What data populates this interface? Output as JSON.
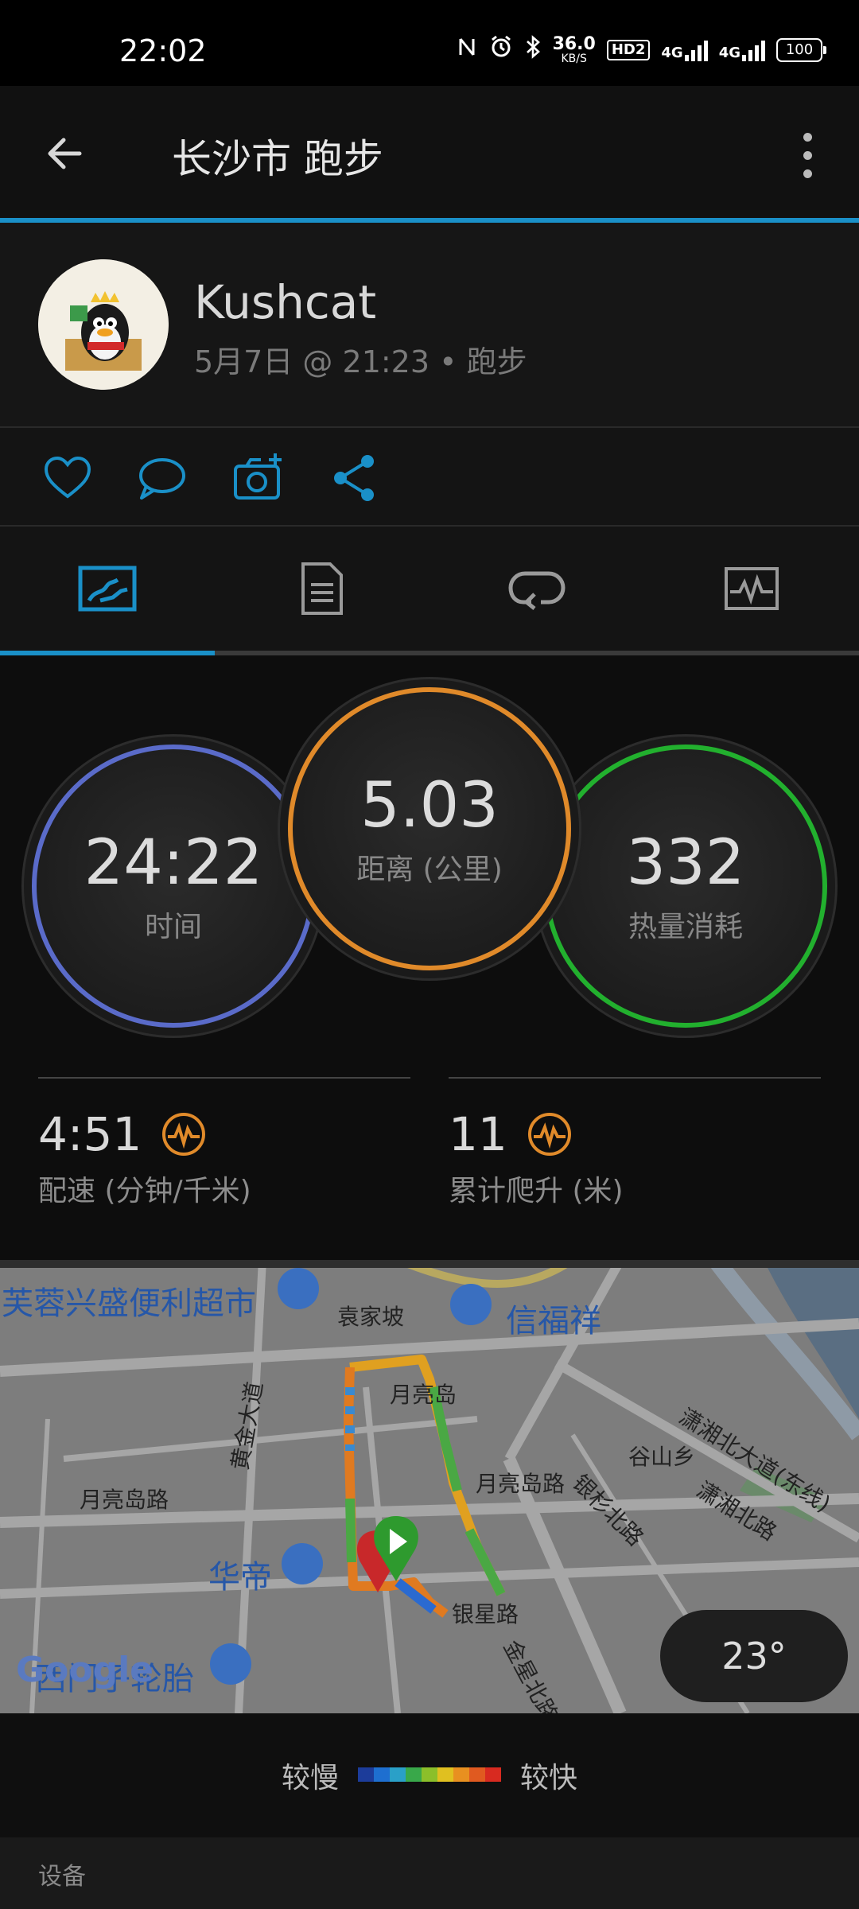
{
  "status": {
    "time": "22:02",
    "speed_value": "36.0",
    "speed_unit": "KB/S",
    "hd_label": "HD2",
    "signal1": "4G",
    "signal2": "4G",
    "battery": "100"
  },
  "header": {
    "title": "长沙市 跑步"
  },
  "profile": {
    "name": "Kushcat",
    "meta": "5月7日 @ 21:23 • 跑步"
  },
  "actions": [
    "like-icon",
    "comment-icon",
    "add-photo-icon",
    "share-icon"
  ],
  "tabs": [
    "overview-icon",
    "details-icon",
    "laps-icon",
    "charts-icon"
  ],
  "stats": {
    "time": {
      "value": "24:22",
      "label": "时间"
    },
    "distance": {
      "value": "5.03",
      "label": "距离 (公里)"
    },
    "calories": {
      "value": "332",
      "label": "热量消耗"
    },
    "pace": {
      "value": "4:51",
      "label": "配速 (分钟/千米)"
    },
    "ascent": {
      "value": "11",
      "label": "累计爬升 (米)"
    }
  },
  "colors": {
    "accent": "#1a90c8",
    "time_ring": "#5a6bc9",
    "distance_ring": "#e08a2a",
    "calories_ring": "#22b02e",
    "pulse_icon": "#e08a2a"
  },
  "map": {
    "labels": {
      "poi1": "芙蓉兴盛便利超市",
      "area1": "袁家坡",
      "poi2": "信福祥",
      "island": "月亮岛",
      "road1": "月亮岛路",
      "road2": "月亮岛路",
      "road3": "黄金大道",
      "village": "谷山乡",
      "road4": "银杉北路",
      "road5": "潇湘北大道(东线)",
      "road6": "潇湘北路",
      "poi3": "华帝",
      "road7": "银星路",
      "road8": "金星北路",
      "poi4": "西门子轮胎",
      "google": "Google"
    },
    "temperature": "23°"
  },
  "legend": {
    "slow": "较慢",
    "fast": "较快",
    "gradient": [
      "#1c3c9a",
      "#1e6fd0",
      "#2aa0c8",
      "#39a84a",
      "#8bbf2a",
      "#e0c020",
      "#e89020",
      "#e05a20",
      "#d82a20"
    ]
  },
  "footer": {
    "label": "设备"
  }
}
